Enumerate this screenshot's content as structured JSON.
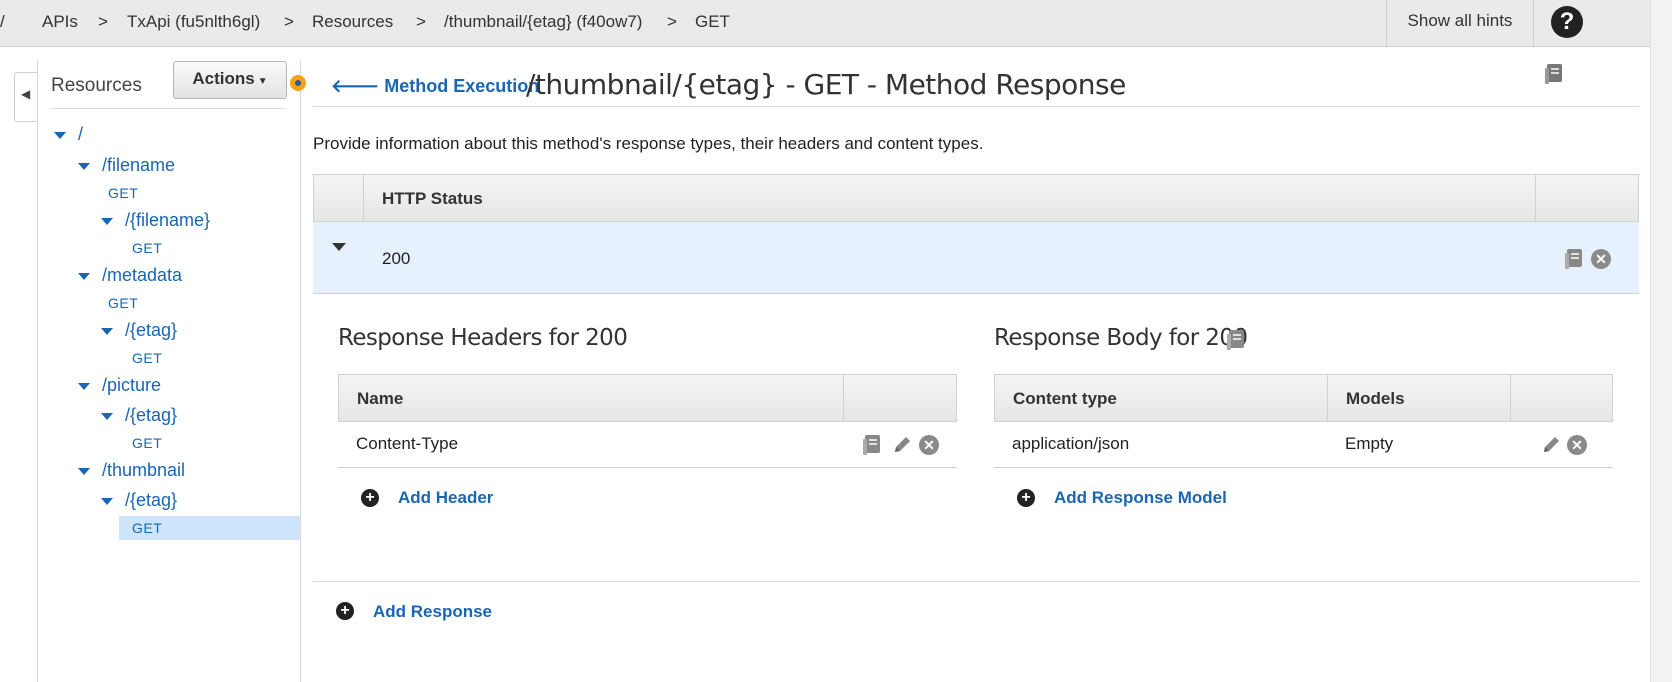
{
  "breadcrumb": {
    "items": [
      "APIs",
      "TxApi (fu5nlth6gl)",
      "Resources",
      "/thumbnail/{etag} (f40ow7)",
      "GET"
    ],
    "separator": ">"
  },
  "header": {
    "hints_label": "Show all hints",
    "help_icon": "?"
  },
  "sidebar": {
    "title": "Resources",
    "actions_label": "Actions",
    "tree": {
      "root": "/",
      "filename": "/filename",
      "filename_get": "GET",
      "filename_param": "/{filename}",
      "filename_param_get": "GET",
      "metadata": "/metadata",
      "metadata_get": "GET",
      "metadata_etag": "/{etag}",
      "metadata_etag_get": "GET",
      "picture": "/picture",
      "picture_etag": "/{etag}",
      "picture_etag_get": "GET",
      "thumbnail": "/thumbnail",
      "thumbnail_etag": "/{etag}",
      "thumbnail_etag_get": "GET"
    }
  },
  "main": {
    "back_label": "Method Execution",
    "title": "/thumbnail/{etag} - GET - Method Response",
    "description": "Provide information about this method's response types, their headers and content types.",
    "status_column": "HTTP Status",
    "status_code": "200",
    "headers_section": {
      "title": "Response Headers for 200",
      "col_name": "Name",
      "rows": [
        {
          "name": "Content-Type"
        }
      ],
      "add_label": "Add Header"
    },
    "body_section": {
      "title": "Response Body for 200",
      "col_content_type": "Content type",
      "col_models": "Models",
      "rows": [
        {
          "content_type": "application/json",
          "model": "Empty"
        }
      ],
      "add_label": "Add Response Model"
    },
    "add_response_label": "Add Response"
  },
  "colors": {
    "link": "#1a66b3",
    "selected_row": "#e6f1fd",
    "hint_dot": "#f7a11a"
  }
}
